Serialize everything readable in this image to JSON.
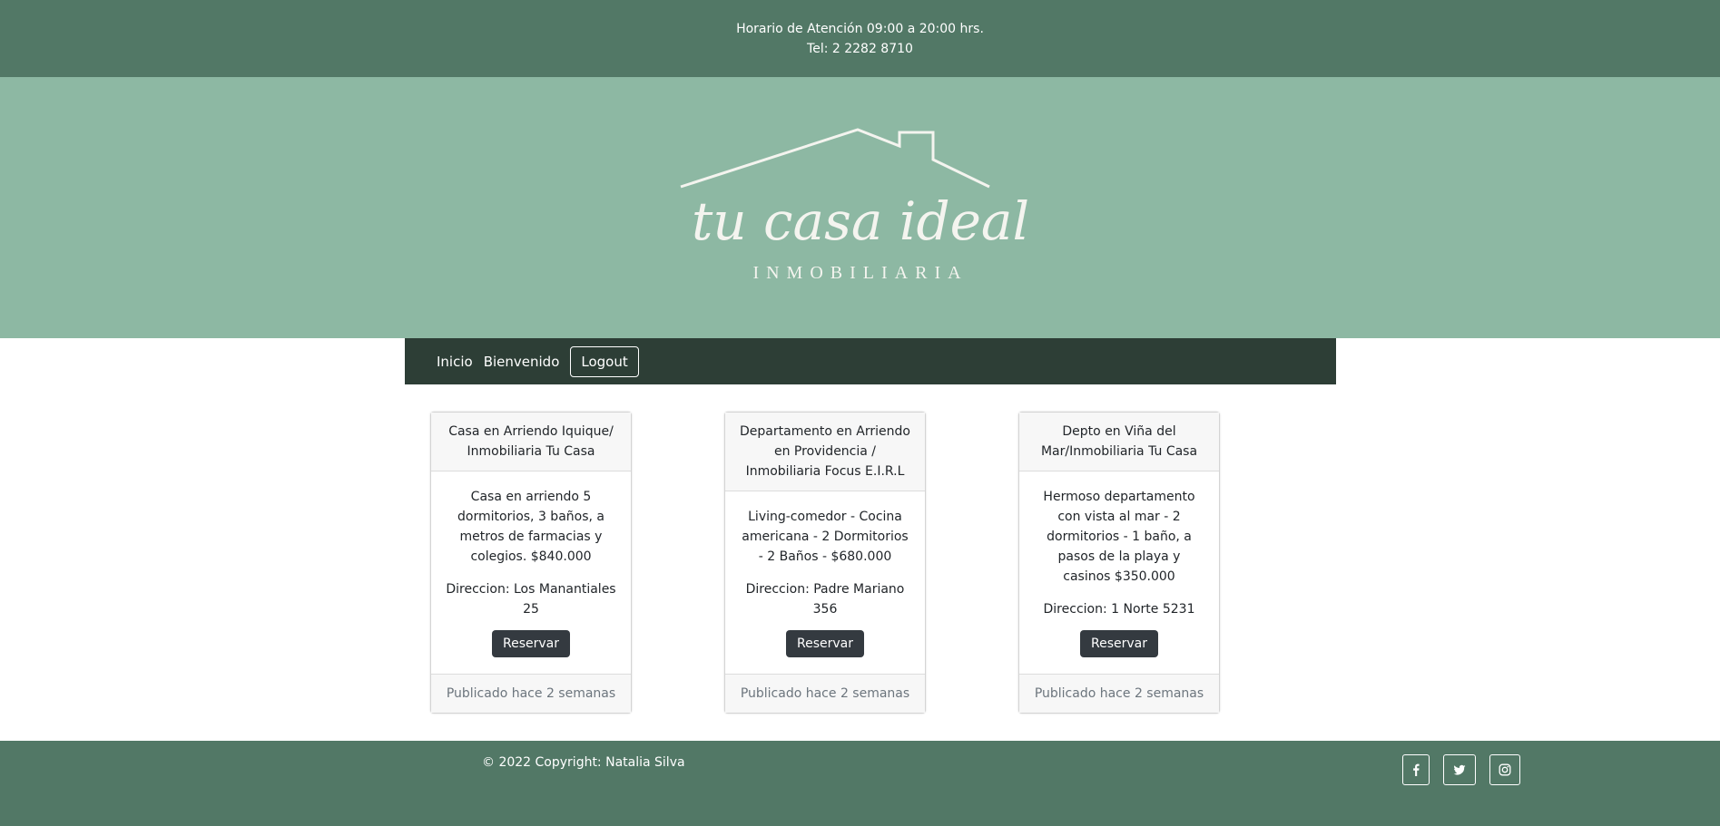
{
  "topbar": {
    "hours": "Horario de Atención 09:00 a 20:00 hrs.",
    "phone": "Tel: 2 2282 8710"
  },
  "logo": {
    "script_text": "tu casa ideal",
    "subtitle": "INMOBILIARIA"
  },
  "nav": {
    "items": [
      {
        "label": "Inicio"
      },
      {
        "label": "Bienvenido"
      }
    ],
    "logout_label": "Logout"
  },
  "cards": [
    {
      "title": "Casa en Arriendo Iquique/ Inmobiliaria Tu Casa",
      "description": "Casa en arriendo 5 dormitorios, 3 baños, a metros de farmacias y colegios. $840.000",
      "address": "Direccion: Los Manantiales 25",
      "button_label": "Reservar",
      "footer": "Publicado hace 2 semanas"
    },
    {
      "title": "Departamento en Arriendo en Providencia / Inmobiliaria Focus E.I.R.L",
      "description": "Living-comedor - Cocina americana - 2 Dormitorios - 2 Baños - $680.000",
      "address": "Direccion: Padre Mariano 356",
      "button_label": "Reservar",
      "footer": "Publicado hace 2 semanas"
    },
    {
      "title": "Depto en Viña del Mar/Inmobiliaria Tu Casa",
      "description": "Hermoso departamento con vista al mar - 2 dormitorios - 1 baño, a pasos de la playa y casinos $350.000",
      "address": "Direccion: 1 Norte 5231",
      "button_label": "Reservar",
      "footer": "Publicado hace 2 semanas"
    }
  ],
  "footer": {
    "copyright": "© 2022 Copyright: Natalia Silva",
    "social": [
      {
        "icon": "facebook-icon"
      },
      {
        "icon": "twitter-icon"
      },
      {
        "icon": "instagram-icon"
      }
    ]
  },
  "colors": {
    "topbar_bg": "#527866",
    "hero_bg": "#8db8a3",
    "nav_bg": "#2d3e36",
    "button_bg": "#343a40",
    "logo_stroke": "#f4f4ef"
  }
}
